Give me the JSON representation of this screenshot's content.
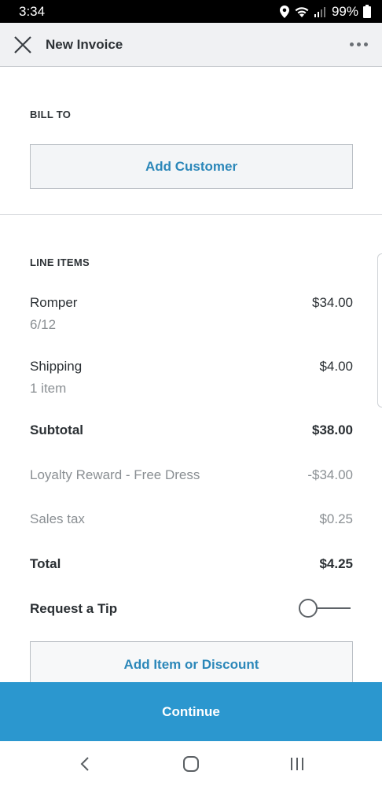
{
  "status_bar": {
    "time": "3:34",
    "battery": "99%"
  },
  "header": {
    "title": "New Invoice"
  },
  "bill_to": {
    "label": "BILL TO",
    "add_customer": "Add Customer"
  },
  "line_items": {
    "label": "LINE ITEMS",
    "items": [
      {
        "name": "Romper",
        "detail": "6/12",
        "price": "$34.00"
      },
      {
        "name": "Shipping",
        "detail": "1 item",
        "price": "$4.00"
      }
    ]
  },
  "summary": {
    "subtotal_label": "Subtotal",
    "subtotal_value": "$38.00",
    "discount_label": "Loyalty Reward - Free Dress",
    "discount_value": "-$34.00",
    "tax_label": "Sales tax",
    "tax_value": "$0.25",
    "total_label": "Total",
    "total_value": "$4.25"
  },
  "tip": {
    "label": "Request a Tip",
    "enabled": false
  },
  "add_item": "Add Item or Discount",
  "continue": "Continue"
}
